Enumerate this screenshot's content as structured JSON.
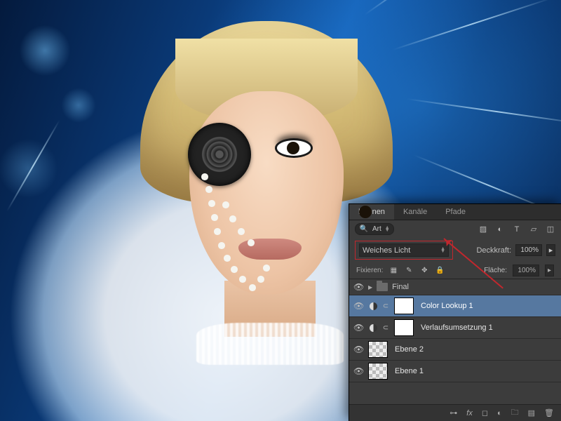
{
  "panel": {
    "tabs": [
      "Ebenen",
      "Kanäle",
      "Pfade"
    ],
    "active_tab": 0,
    "filter": {
      "icon": "search-icon",
      "label": "Art"
    },
    "filter_icons": [
      "image-icon",
      "adjust-icon",
      "type-icon",
      "shape-icon",
      "smartobj-icon"
    ],
    "blend_mode": {
      "value": "Weiches Licht"
    },
    "opacity": {
      "label": "Deckkraft:",
      "value": "100%"
    },
    "lock": {
      "label": "Fixieren:",
      "icons": [
        "lock-transparent-icon",
        "lock-image-icon",
        "lock-position-icon",
        "lock-all-icon"
      ]
    },
    "fill": {
      "label": "Fläche:",
      "value": "100%"
    },
    "group": {
      "name": "Final",
      "expanded": false
    },
    "layers": [
      {
        "name": "Color Lookup 1",
        "visible": true,
        "adjustment": true,
        "mask": true,
        "selected": true
      },
      {
        "name": "Verlaufsumsetzung 1",
        "visible": true,
        "adjustment": true,
        "mask": true,
        "selected": false
      },
      {
        "name": "Ebene 2",
        "visible": true,
        "adjustment": false,
        "mask": false,
        "selected": false,
        "transparent": true
      },
      {
        "name": "Ebene 1",
        "visible": true,
        "adjustment": false,
        "mask": false,
        "selected": false,
        "transparent": true
      }
    ],
    "bottom_icons": [
      "link-icon",
      "fx-icon",
      "mask-icon",
      "adjustment-icon",
      "group-icon",
      "new-layer-icon",
      "trash-icon"
    ]
  },
  "colors": {
    "highlight": "#c1272d",
    "panel_bg": "#3c3c3c",
    "selected": "#5678a0"
  }
}
